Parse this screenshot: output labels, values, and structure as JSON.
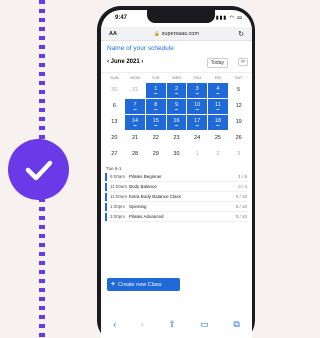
{
  "status": {
    "time": "9:47",
    "system": "▮▮▮ ◠ ▭"
  },
  "browser": {
    "aa": "AA",
    "url": "supersaas.com"
  },
  "schedule": {
    "title": "Name of your schedule",
    "month_nav": "‹ June 2021 ›",
    "today_label": "Today",
    "arrows": "‹›"
  },
  "calendar": {
    "days_of_week": [
      "SUN",
      "MON",
      "TUE",
      "WED",
      "THU",
      "FRI",
      "SAT"
    ],
    "weeks": [
      [
        {
          "d": "30",
          "m": true
        },
        {
          "d": "31",
          "m": true
        },
        {
          "d": "1",
          "s": true
        },
        {
          "d": "2",
          "s": true
        },
        {
          "d": "3",
          "s": true
        },
        {
          "d": "4",
          "s": true
        },
        {
          "d": "5"
        }
      ],
      [
        {
          "d": "6"
        },
        {
          "d": "7",
          "s": true
        },
        {
          "d": "8",
          "s": true
        },
        {
          "d": "9",
          "s": true
        },
        {
          "d": "10",
          "s": true
        },
        {
          "d": "11",
          "s": true
        },
        {
          "d": "12"
        }
      ],
      [
        {
          "d": "13"
        },
        {
          "d": "14",
          "s": true
        },
        {
          "d": "15",
          "s": true
        },
        {
          "d": "16",
          "s": true
        },
        {
          "d": "17",
          "s": true
        },
        {
          "d": "18",
          "s": true
        },
        {
          "d": "19"
        }
      ],
      [
        {
          "d": "20"
        },
        {
          "d": "21"
        },
        {
          "d": "22"
        },
        {
          "d": "23"
        },
        {
          "d": "24"
        },
        {
          "d": "25"
        },
        {
          "d": "26"
        }
      ],
      [
        {
          "d": "27"
        },
        {
          "d": "28"
        },
        {
          "d": "29"
        },
        {
          "d": "30"
        },
        {
          "d": "1",
          "m": true
        },
        {
          "d": "2",
          "m": true
        },
        {
          "d": "3",
          "m": true
        }
      ]
    ]
  },
  "classes_header": "Tue 6-1",
  "classes": [
    {
      "time": "9:00am",
      "name": "Pilates Beginner",
      "count": "1 / 5"
    },
    {
      "time": "11:00am",
      "name": "Body Balance",
      "count": "3 / 4"
    },
    {
      "time": "11:00am",
      "name": "Extra Body Balance Class",
      "count": "0 / 10"
    },
    {
      "time": "1:00pm",
      "name": "Spinning",
      "count": "0 / 10"
    },
    {
      "time": "3:00pm",
      "name": "Pilates Advanced",
      "count": "0 / 10"
    }
  ],
  "create_button": {
    "plus": "+",
    "label": "Create new Class"
  },
  "icons": {
    "toolbar": [
      "back-icon",
      "forward-icon",
      "share-icon",
      "bookmarks-icon",
      "tabs-icon"
    ]
  },
  "colors": {
    "accent": "#1f6ad8",
    "badge": "#6a39e8"
  }
}
